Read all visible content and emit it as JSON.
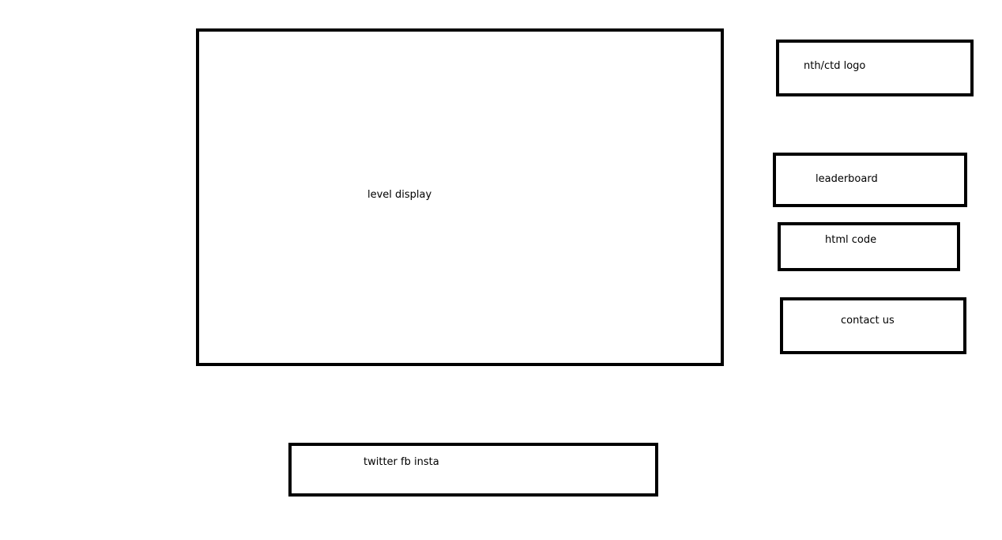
{
  "level_display": {
    "label": "level display"
  },
  "logo": {
    "label": "nth/ctd logo"
  },
  "leaderboard": {
    "label": "leaderboard"
  },
  "html_code": {
    "label": "html code"
  },
  "contact_us": {
    "label": "contact us"
  },
  "social": {
    "label": "twitter fb insta"
  },
  "colors": {
    "border": "#000000",
    "background": "#ffffff",
    "text": "#000000"
  }
}
